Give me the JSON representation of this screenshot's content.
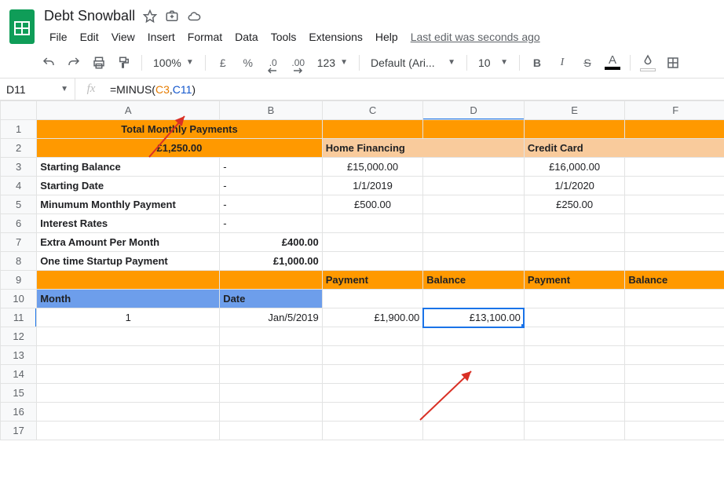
{
  "doc": {
    "title": "Debt Snowball"
  },
  "menubar": {
    "items": [
      "File",
      "Edit",
      "View",
      "Insert",
      "Format",
      "Data",
      "Tools",
      "Extensions",
      "Help"
    ],
    "last_edit": "Last edit was seconds ago"
  },
  "toolbar": {
    "zoom": "100%",
    "currency": "£",
    "percent": "%",
    "dec_dec": ".0",
    "inc_dec": ".00",
    "num_format": "123",
    "font": "Default (Ari...",
    "font_size": "10",
    "bold": "B",
    "italic": "I",
    "strike": "S",
    "text_color_letter": "A"
  },
  "fx": {
    "name_box": "D11",
    "formula_fn": "=MINUS(",
    "formula_ref1": "C3",
    "formula_comma": ",",
    "formula_ref2": "C11",
    "formula_close": ")"
  },
  "columns": [
    "A",
    "B",
    "C",
    "D",
    "E",
    "F"
  ],
  "rows": [
    "1",
    "2",
    "3",
    "4",
    "5",
    "6",
    "7",
    "8",
    "9",
    "10",
    "11",
    "12",
    "13",
    "14",
    "15",
    "16",
    "17"
  ],
  "cells": {
    "r1": {
      "ab_merged": "Total Monthly Payments"
    },
    "r2": {
      "ab_merged": "£1,250.00",
      "c": "Home Financing",
      "e": "Credit Card"
    },
    "r3": {
      "a": "Starting Balance",
      "b": "-",
      "c": "£15,000.00",
      "e": "£16,000.00"
    },
    "r4": {
      "a": "Starting Date",
      "b": "-",
      "c": "1/1/2019",
      "e": "1/1/2020"
    },
    "r5": {
      "a": "Minumum Monthly Payment",
      "b": "-",
      "c": "£500.00",
      "e": "£250.00"
    },
    "r6": {
      "a": "Interest Rates",
      "b": "-"
    },
    "r7": {
      "a": "Extra Amount Per Month",
      "b": "£400.00"
    },
    "r8": {
      "a": "One time Startup Payment",
      "b": "£1,000.00"
    },
    "r9": {
      "c": "Payment",
      "d": "Balance",
      "e": "Payment",
      "f": "Balance"
    },
    "r10": {
      "a": "Month",
      "b": "Date"
    },
    "r11": {
      "a": "1",
      "b": "Jan/5/2019",
      "c": "£1,900.00",
      "d": "£13,100.00"
    }
  },
  "chart_data": null
}
